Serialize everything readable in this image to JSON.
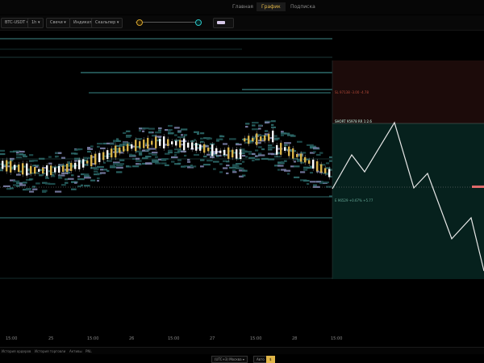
{
  "nav": {
    "tabs": [
      "Главная",
      "График",
      "Подписка"
    ],
    "active_index": 1
  },
  "toolbar": {
    "symbol": "BTC-USDT ▾",
    "interval": "1h ▾",
    "candles": "Свечи ▾",
    "indicators": "Индикаторы",
    "scalper": "Скальпер ▾",
    "slider_values": [
      0.12,
      0.88
    ],
    "color_swatch": "#d6c8e8"
  },
  "chart": {
    "long_label": "SL 97138 -3.00 -4.78",
    "short_label": "SHORT 95978 RR 1:2.6",
    "entry_label": "E 96529 +0.67% +5.77"
  },
  "x_axis": {
    "labels": [
      "15:00",
      "25",
      "15:00",
      "26",
      "15:00",
      "27",
      "15:00",
      "28",
      "15:00"
    ]
  },
  "bottom_tabs": [
    "История ордеров",
    "История торговли",
    "Активы",
    "PNL"
  ],
  "footer": {
    "timezone": "(UTC+3) Москва ▾",
    "mode": "Авто",
    "mode_badge": "$"
  },
  "colors": {
    "accent": "#e0b548",
    "cluster": "#2e6a6a",
    "bull": "#d6b24a",
    "bear": "#ffffff",
    "long_zone": "#1c0b0a",
    "short_zone": "#06211d"
  }
}
